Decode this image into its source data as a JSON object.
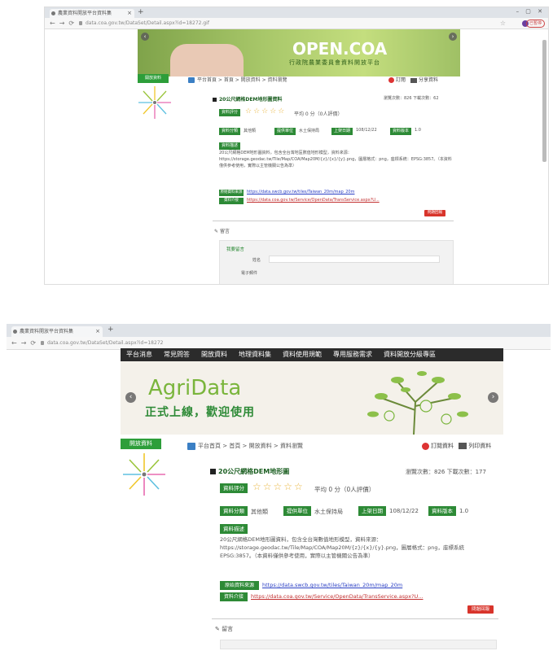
{
  "shot1": {
    "tab_title": "農業資料開放平台資料集",
    "address": "data.coa.gov.tw/DataSet/Detail.aspx?id=18272.gif",
    "banner": {
      "title": "OPEN.COA",
      "subtitle": "行政院農業委員會資料開放平台"
    },
    "sidebar_button": "開放資料",
    "breadcrumb": "平台首頁 > 首頁 > 開放資料 > 資料瀏覽",
    "actions": {
      "subscribe": "訂閱",
      "print": "列印",
      "share": "分享資料"
    },
    "dataset_title": "20公尺網格DEM地形圖資料",
    "views_text": "瀏覽次數：826   下載次數：62",
    "rating_label": "資料評分",
    "rating_text": "平均 0 分（0人評價）",
    "fields": [
      {
        "label": "資料分類",
        "value": "其他類"
      },
      {
        "label": "提供單位",
        "value": "水土保持局"
      },
      {
        "label": "上架日期",
        "value": "108/12/22"
      },
      {
        "label": "資料版本",
        "value": "1.0"
      }
    ],
    "desc_label": "資料描述",
    "desc": "20公尺網格DEM地形圖資料，包含全台灣地區數值地形模型，資料來源：https://storage.geodac.tw/Tile/Map/COA/Map20M/{z}/{x}/{y}.png，圖層格式：png，座標系統：EPSG:3857。（本資料僅供參考使用，實際以主管機關公告為準）",
    "link1_label": "原始資料來源",
    "link1": "https://data.swcb.gov.tw/tiles/Taiwan_20m/map_20m",
    "link2_label": "資料介接",
    "link2": "https://data.coa.gov.tw/Service/OpenData/TransService.aspx?U...",
    "report": "問題回報",
    "comment_title": "留言",
    "comment_box": "我要留言",
    "name_label": "姓名",
    "email_label": "電子郵件"
  },
  "shot2": {
    "tab_title": "農業資料開放平台資料集",
    "address": "data.coa.gov.tw/DataSet/Detail.aspx?id=18272",
    "topnav": [
      "平台消息",
      "常見問答",
      "開放資料",
      "地理資料集",
      "資料使用規範",
      "專用服務需求",
      "資料開放分級專區"
    ],
    "banner": {
      "title": "AgriData",
      "subtitle": "正式上線，歡迎使用"
    },
    "sidebar_button": "開放資料",
    "breadcrumb": "平台首頁 > 首頁 > 開放資料 > 資料瀏覽",
    "actions": {
      "subscribe": "訂閱資料",
      "print": "列印資料"
    },
    "dataset_title": "20公尺網格DEM地形圖",
    "views_text": "瀏覽次數：826   下載次數：177",
    "rating_label": "資料評分",
    "rating_text": "平均 0 分（0人評價）",
    "fields": [
      {
        "label": "資料分類",
        "value": "其他類"
      },
      {
        "label": "提供單位",
        "value": "水土保持局"
      },
      {
        "label": "上架日期",
        "value": "108/12/22"
      },
      {
        "label": "資料版本",
        "value": "1.0"
      }
    ],
    "desc_label": "資料描述",
    "desc": "20公尺網格DEM地形圖資料，包含全台灣數值地形模型，資料來源：https://storage.geodac.tw/Tile/Map/COA/Map20M/{z}/{x}/{y}.png，圖層格式：png，座標系統 EPSG:3857。（本資料僅供參考使用，實際以主管機關公告為準）",
    "link1_label": "原始資料來源",
    "link1": "https://data.swcb.gov.tw/tiles/Taiwan_20m/map_20m",
    "link2_label": "資料介接",
    "link2": "https://data.coa.gov.tw/Service/OpenData/TransService.aspx?U...",
    "report": "問題回報",
    "comment_title": "留言"
  },
  "colors": {
    "green": "#2d8a36",
    "red": "#d8342b",
    "link": "#2a3fc4",
    "nav_dark": "#2b2b2b"
  }
}
